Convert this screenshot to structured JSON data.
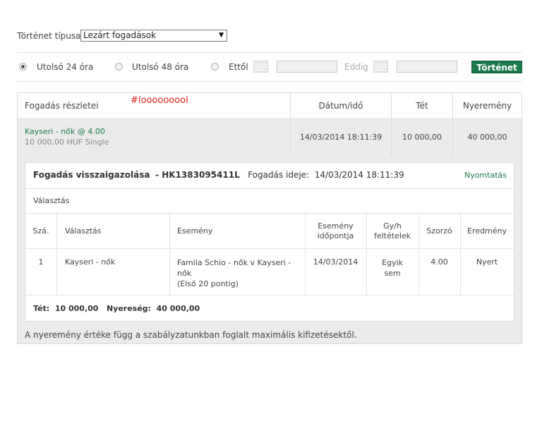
{
  "filter": {
    "type_label": "Történet típusa",
    "type_selected": "Lezárt fogadások",
    "radio_24h": "Utolsó 24 óra",
    "radio_48h": "Utolsó 48 óra",
    "from_label": "Ettől",
    "until_label": "Eddig",
    "history_button": "Történet",
    "selected_radio": "24h"
  },
  "table": {
    "headers": {
      "details": "Fogadás részletei",
      "datetime": "Dátum/idő",
      "stake": "Tét",
      "winnings": "Nyeremény"
    },
    "annotation": "#looooooool",
    "bet": {
      "title": "Kayseri - nők @ 4.00",
      "subtitle": "10 000,00 HUF  Single",
      "datetime": "14/03/2014 18:11:39",
      "stake": "10 000,00",
      "winnings": "40 000,00"
    }
  },
  "confirmation": {
    "title": "Fogadás visszaigazolása",
    "ref": "- HK1383095411L",
    "time_label": "Fogadás ideje:",
    "time_value": "14/03/2014 18:11:39",
    "print_link": "Nyomtatás",
    "section_label": "Választás",
    "columns": {
      "num": "Szá.",
      "selection": "Választás",
      "event": "Esemény",
      "event_time_1": "Esemény",
      "event_time_2": "időpontja",
      "ew_1": "Gy/h",
      "ew_2": "feltételek",
      "odds": "Szorzó",
      "result": "Eredmény"
    },
    "row": {
      "num": "1",
      "selection": "Kayseri - nők",
      "event_1": "Famila Schio - nők v Kayseri -",
      "event_2": "nők",
      "event_3": "(Első 20 pontig)",
      "event_time": "14/03/2014",
      "ew_1": "Egyik",
      "ew_2": "sem",
      "odds": "4.00",
      "result": "Nyert"
    },
    "footer": {
      "stake_label": "Tét:",
      "stake_value": "10 000,00",
      "profit_label": "Nyereség:",
      "profit_value": "40 000,00"
    }
  },
  "note": "A nyeremény értéke függ a szabályzatunkban foglalt maximális kifizetésektől.",
  "colors": {
    "green": "#1d7a4a",
    "annotation_red": "#e0201a",
    "row_gray": "#ebebeb"
  }
}
